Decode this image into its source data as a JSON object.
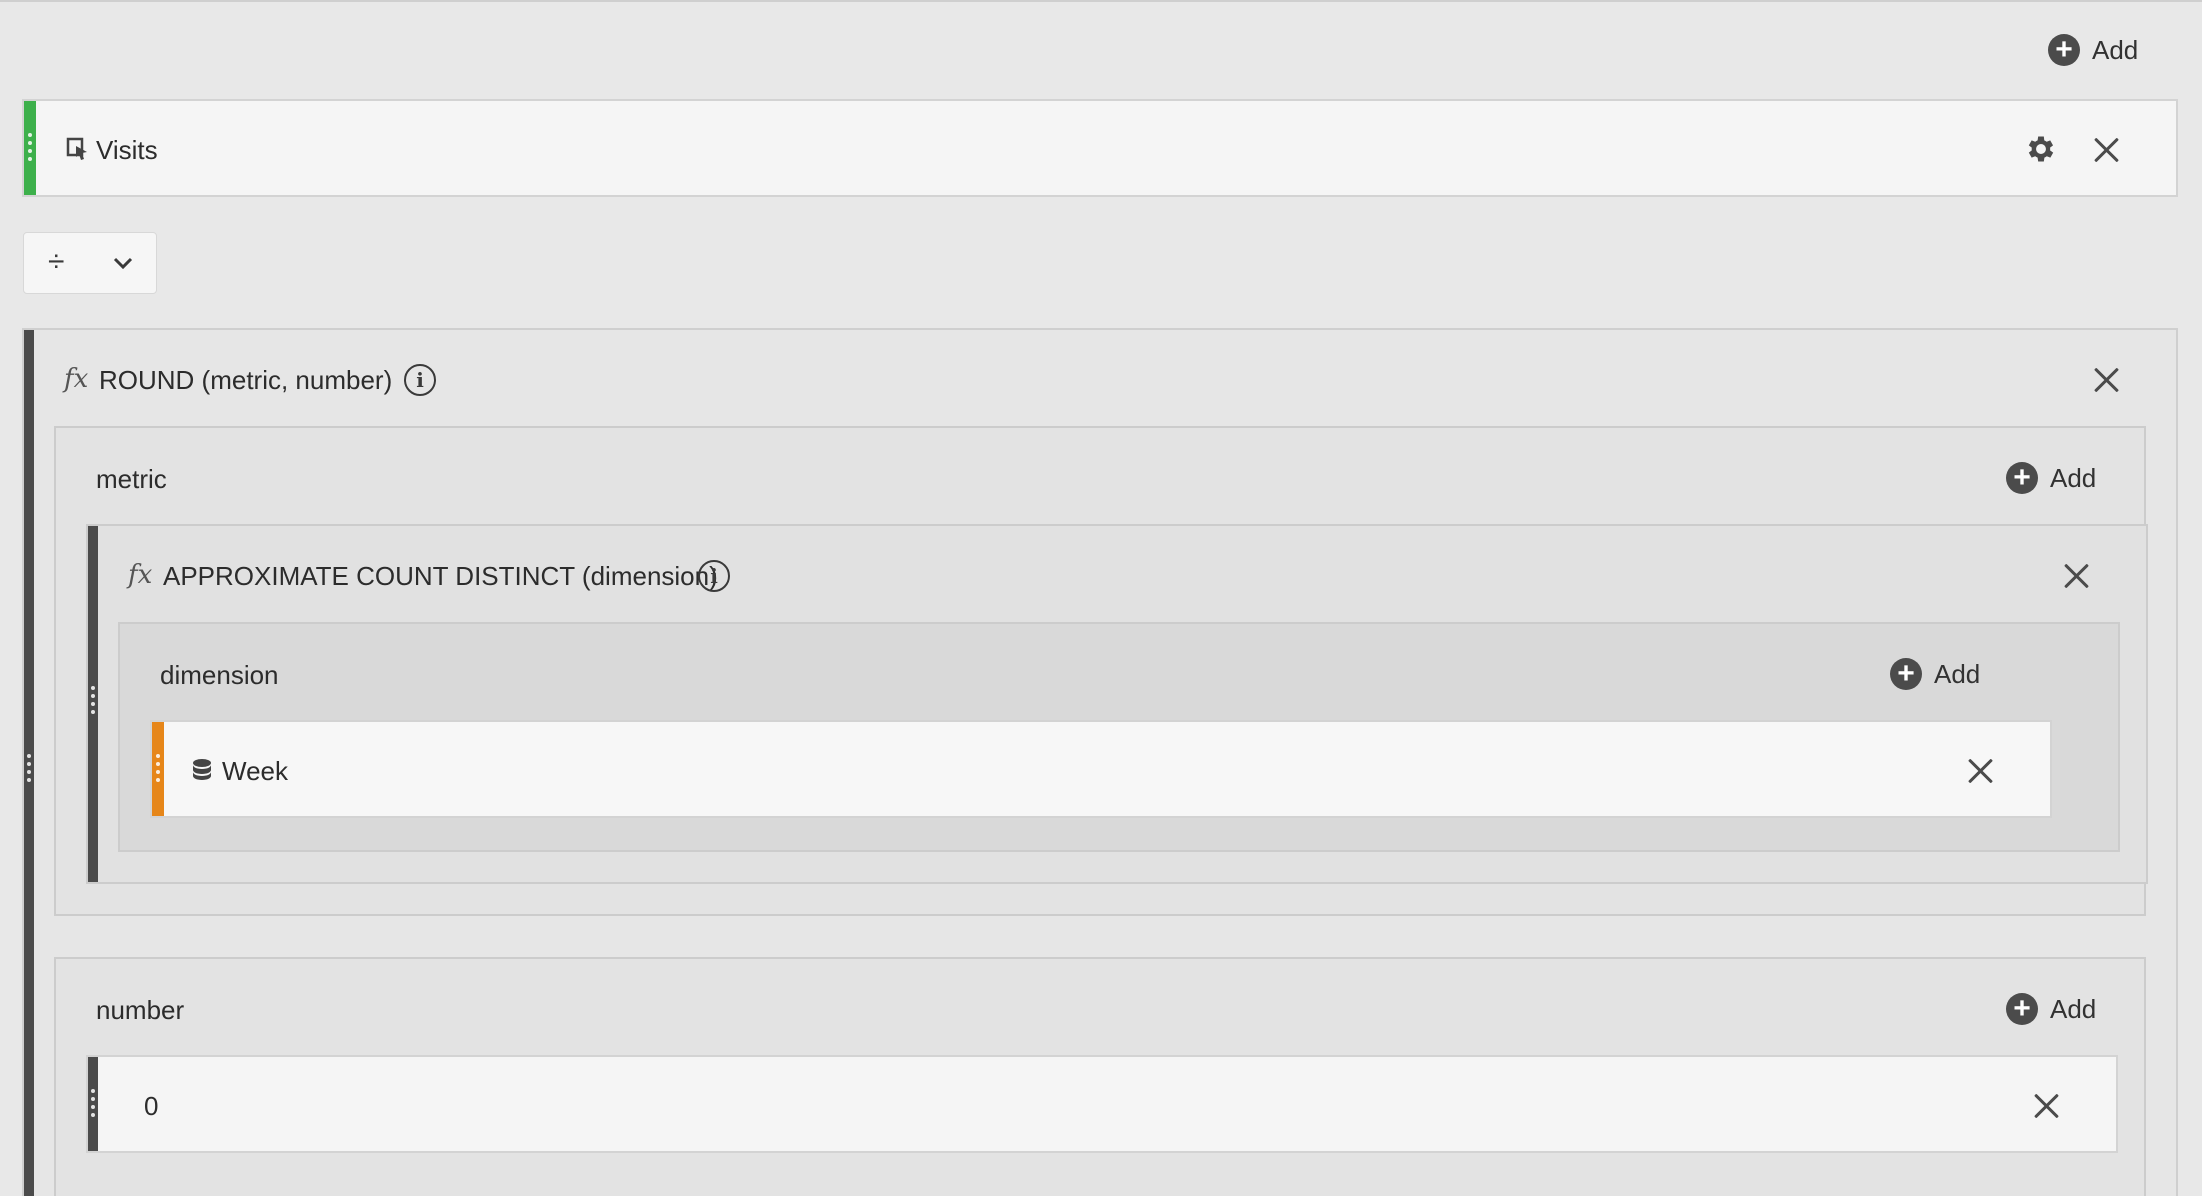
{
  "top": {
    "add_label": "Add"
  },
  "visits": {
    "label": "Visits",
    "icon": "metric-icon"
  },
  "operator": {
    "symbol": "÷"
  },
  "round": {
    "fx": "fx",
    "title": "ROUND (metric, number)"
  },
  "metric_section": {
    "label": "metric",
    "add_label": "Add"
  },
  "acd": {
    "fx": "fx",
    "title": "APPROXIMATE COUNT DISTINCT (dimension)"
  },
  "dimension_section": {
    "label": "dimension",
    "add_label": "Add"
  },
  "week": {
    "label": "Week",
    "icon": "dimension-icon"
  },
  "number_section": {
    "label": "number",
    "add_label": "Add",
    "value": "0"
  },
  "colors": {
    "metric_accent": "#3db04b",
    "dimension_accent": "#e68619",
    "function_accent": "#4b4b4b",
    "background": "#e8e8e8"
  }
}
